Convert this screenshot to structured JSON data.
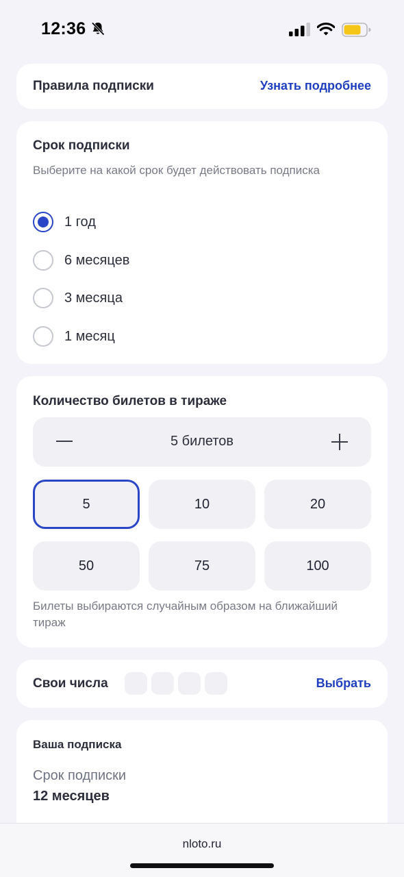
{
  "status_bar": {
    "time": "12:36"
  },
  "colors": {
    "accent": "#2a45c6",
    "link": "#1f3fc0",
    "background": "#f3f3f9",
    "card": "#ffffff",
    "battery": "#f5c518"
  },
  "rules": {
    "title": "Правила подписки",
    "link": "Узнать подробнее"
  },
  "term": {
    "title": "Срок подписки",
    "description": "Выберите на какой срок будет действовать подписка",
    "options": [
      {
        "label": "1 год",
        "selected": true
      },
      {
        "label": "6 месяцев",
        "selected": false
      },
      {
        "label": "3 месяца",
        "selected": false
      },
      {
        "label": "1 месяц",
        "selected": false
      }
    ]
  },
  "tickets": {
    "title": "Количество билетов в тираже",
    "stepper_value": "5 билетов",
    "options": [
      {
        "label": "5",
        "selected": true
      },
      {
        "label": "10",
        "selected": false
      },
      {
        "label": "20",
        "selected": false
      },
      {
        "label": "50",
        "selected": false
      },
      {
        "label": "75",
        "selected": false
      },
      {
        "label": "100",
        "selected": false
      }
    ],
    "note": "Билеты выбираются случайным образом на ближайший тираж"
  },
  "own_numbers": {
    "title": "Свои числа",
    "link": "Выбрать"
  },
  "subscription": {
    "title": "Ваша подписка",
    "term_label": "Срок подписки",
    "term_value": "12 месяцев"
  },
  "browser": {
    "url": "nloto.ru"
  }
}
